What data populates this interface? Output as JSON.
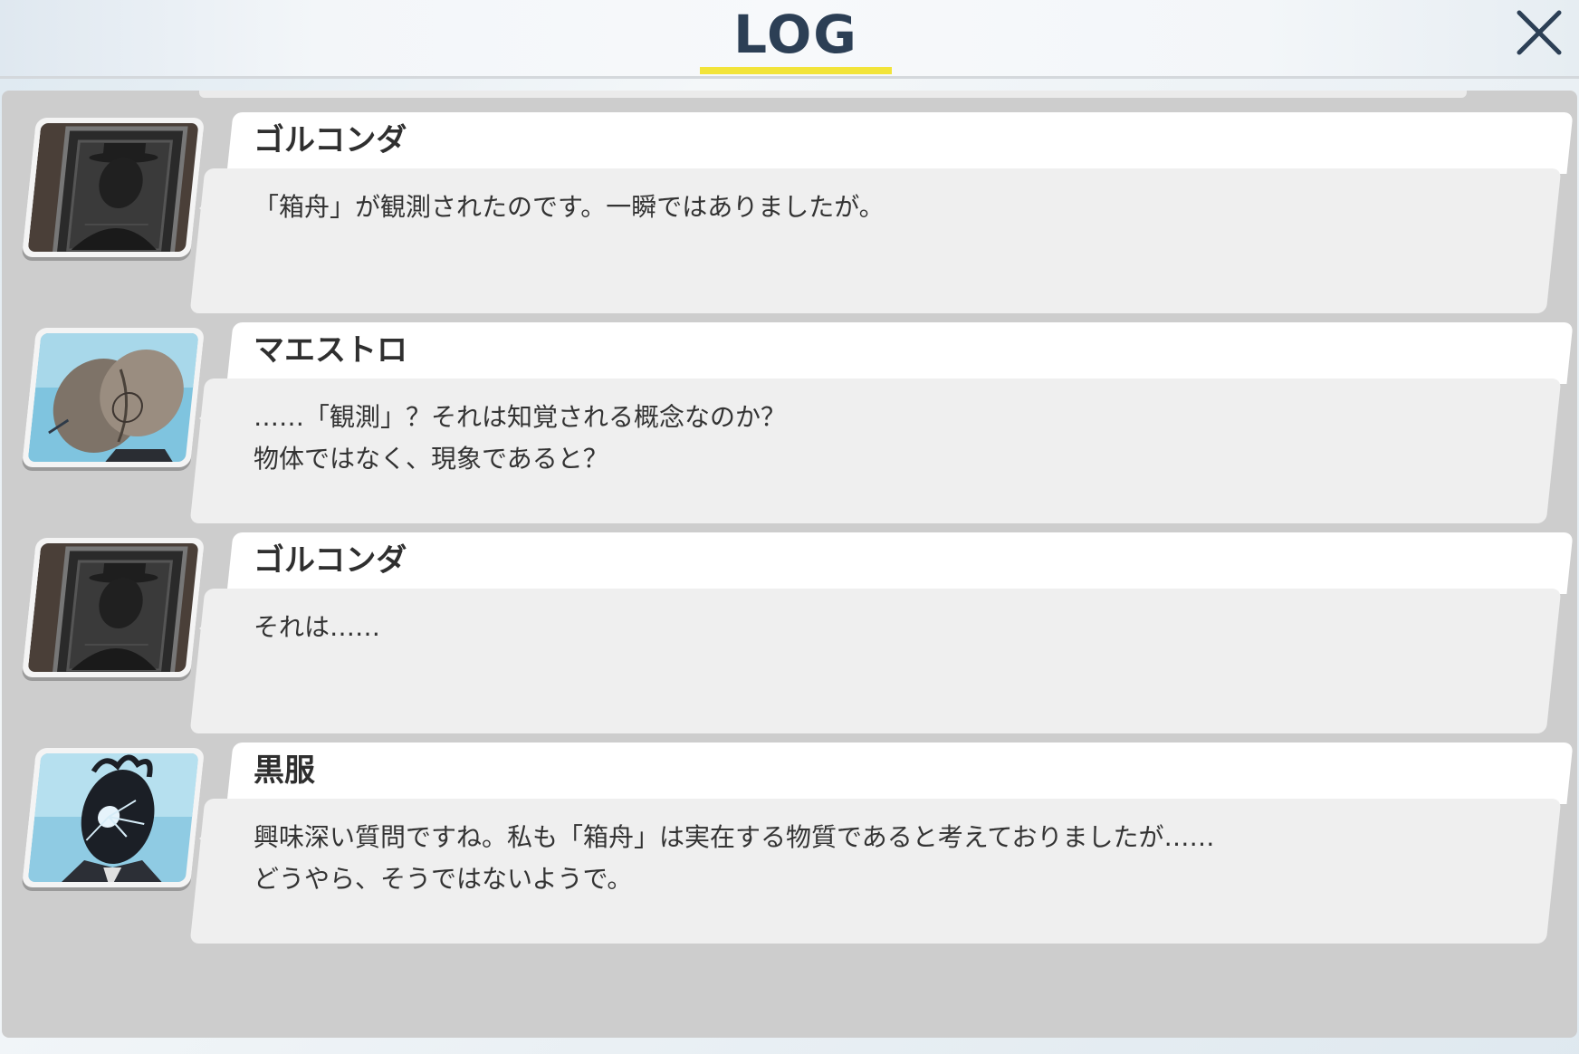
{
  "header": {
    "title": "LOG",
    "close_icon": "close-icon"
  },
  "colors": {
    "title": "#2c3f55",
    "underline": "#f2e43a",
    "panel": "#cdcdcd",
    "name_tab": "#ffffff",
    "speech_box": "#efefef"
  },
  "log": {
    "entries": [
      {
        "speaker": "ゴルコンダ",
        "avatar": "golconda-portrait",
        "lines": [
          "「箱舟」が観測されたのです。一瞬ではありましたが。"
        ]
      },
      {
        "speaker": "マエストロ",
        "avatar": "maestro-portrait",
        "lines": [
          "……「観測」？それは知覚される概念なのか？",
          "物体ではなく、現象であると？"
        ]
      },
      {
        "speaker": "ゴルコンダ",
        "avatar": "golconda-portrait",
        "lines": [
          "それは……"
        ]
      },
      {
        "speaker": "黒服",
        "avatar": "kurofuku-portrait",
        "lines": [
          "興味深い質問ですね。私も「箱舟」は実在する物質であると考えておりましたが……",
          "どうやら、そうではないようで。"
        ]
      }
    ]
  }
}
